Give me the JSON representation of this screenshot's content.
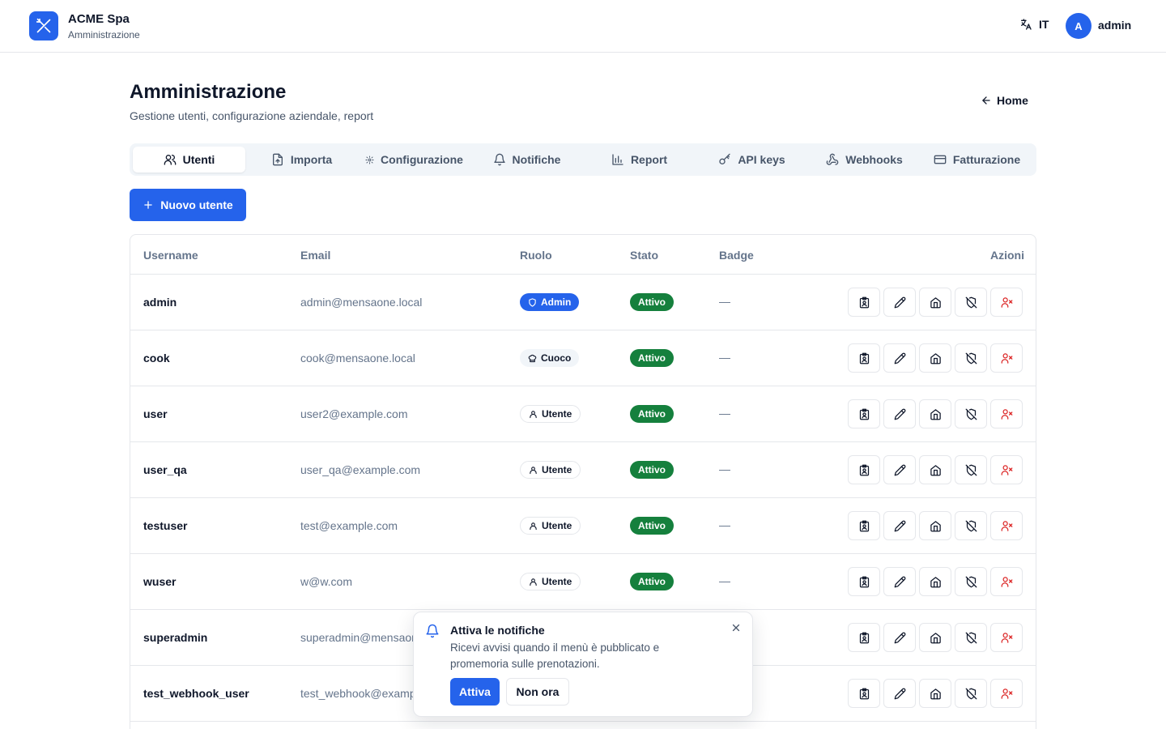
{
  "header": {
    "brand_name": "ACME Spa",
    "brand_sub": "Amministrazione",
    "language": "IT",
    "avatar_initial": "A",
    "username": "admin",
    "accent": "#2563eb"
  },
  "page": {
    "title": "Amministrazione",
    "subtitle": "Gestione utenti, configurazione aziendale, report",
    "home_label": "Home"
  },
  "tabs": [
    {
      "label": "Utenti",
      "icon": "users-icon",
      "active": true
    },
    {
      "label": "Importa",
      "icon": "file-upload-icon",
      "active": false
    },
    {
      "label": "Configurazione",
      "icon": "gear-icon",
      "active": false
    },
    {
      "label": "Notifiche",
      "icon": "bell-icon",
      "active": false
    },
    {
      "label": "Report",
      "icon": "bar-chart-icon",
      "active": false
    },
    {
      "label": "API keys",
      "icon": "key-icon",
      "active": false
    },
    {
      "label": "Webhooks",
      "icon": "webhook-icon",
      "active": false
    },
    {
      "label": "Fatturazione",
      "icon": "credit-card-icon",
      "active": false
    }
  ],
  "new_user_label": "Nuovo utente",
  "table": {
    "columns": [
      "Username",
      "Email",
      "Ruolo",
      "Stato",
      "Badge",
      "Azioni"
    ],
    "rows": [
      {
        "username": "admin",
        "email": "admin@mensaone.local",
        "role": "Admin",
        "role_type": "admin",
        "status": "Attivo",
        "badge": "—"
      },
      {
        "username": "cook",
        "email": "cook@mensaone.local",
        "role": "Cuoco",
        "role_type": "cuoco",
        "status": "Attivo",
        "badge": "—"
      },
      {
        "username": "user",
        "email": "user2@example.com",
        "role": "Utente",
        "role_type": "utente",
        "status": "Attivo",
        "badge": "—"
      },
      {
        "username": "user_qa",
        "email": "user_qa@example.com",
        "role": "Utente",
        "role_type": "utente",
        "status": "Attivo",
        "badge": "—"
      },
      {
        "username": "testuser",
        "email": "test@example.com",
        "role": "Utente",
        "role_type": "utente",
        "status": "Attivo",
        "badge": "—"
      },
      {
        "username": "wuser",
        "email": "w@w.com",
        "role": "Utente",
        "role_type": "utente",
        "status": "Attivo",
        "badge": "—"
      },
      {
        "username": "superadmin",
        "email": "superadmin@mensaor",
        "role": "",
        "role_type": "",
        "status": "",
        "badge": ""
      },
      {
        "username": "test_webhook_user",
        "email": "test_webhook@examp",
        "role": "",
        "role_type": "",
        "status": "",
        "badge": ""
      }
    ],
    "row_actions": [
      "badge-icon",
      "pencil-icon",
      "home-icon",
      "shield-off-icon",
      "user-remove-icon"
    ]
  },
  "toast": {
    "title": "Attiva le notifiche",
    "text": "Ricevi avvisi quando il menù è pubblicato e promemoria sulle prenotazioni.",
    "primary_label": "Attiva",
    "secondary_label": "Non ora"
  },
  "colors": {
    "success": "#15803d",
    "danger": "#dc2626"
  }
}
